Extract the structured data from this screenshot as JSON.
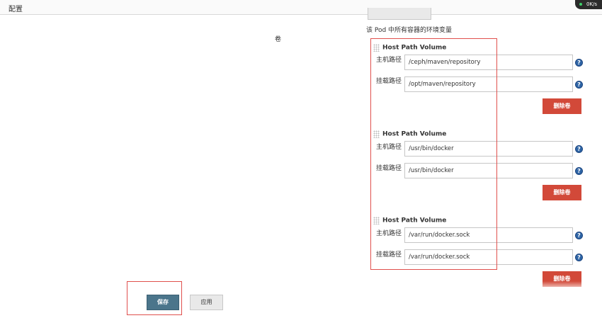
{
  "breadcrumb": {
    "label": "配置"
  },
  "speed_widget": {
    "text": "0K/s"
  },
  "env_description": "该 Pod 中所有容器的环境变量",
  "volumes_label": "卷",
  "volumes": [
    {
      "title": "Host Path Volume",
      "host_path_label": "主机路径",
      "host_path": "/ceph/maven/repository",
      "mount_path_label": "挂载路径",
      "mount_path": "/opt/maven/repository",
      "delete_label": "删除卷"
    },
    {
      "title": "Host Path Volume",
      "host_path_label": "主机路径",
      "host_path": "/usr/bin/docker",
      "mount_path_label": "挂载路径",
      "mount_path": "/usr/bin/docker",
      "delete_label": "删除卷"
    },
    {
      "title": "Host Path Volume",
      "host_path_label": "主机路径",
      "host_path": "/var/run/docker.sock",
      "mount_path_label": "挂载路径",
      "mount_path": "/var/run/docker.sock",
      "delete_label": "删除卷"
    }
  ],
  "actions": {
    "save_label": "保存",
    "apply_label": "应用"
  },
  "colors": {
    "highlight": "#e0504d",
    "delete": "#d24939",
    "save": "#4b758b",
    "help": "#2f65a6"
  },
  "icons": {
    "help": "help-icon",
    "drag": "drag-handle-icon"
  }
}
